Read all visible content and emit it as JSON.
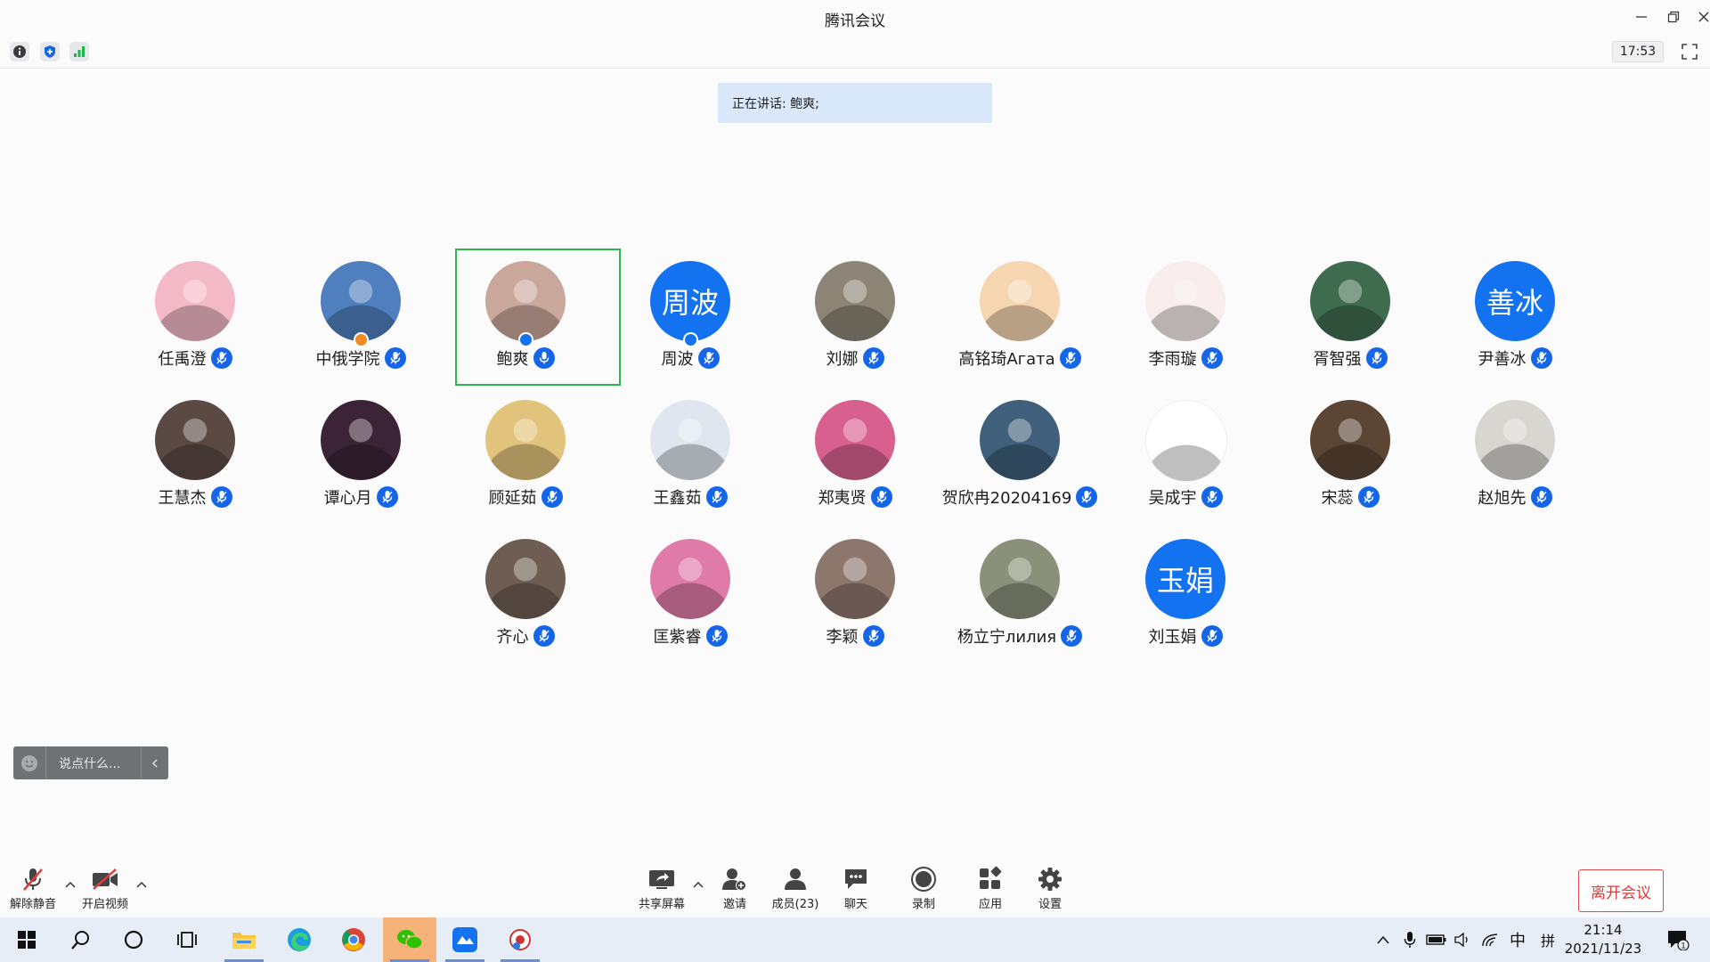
{
  "window": {
    "title": "腾讯会议"
  },
  "infobar": {
    "timer": "17:53"
  },
  "speaking": {
    "label": "正在讲话: 鲍爽;"
  },
  "participants": [
    {
      "name": "任禹澄",
      "avatar": "photo",
      "color": "#f4b9c7"
    },
    {
      "name": "中俄学院",
      "avatar": "photo",
      "color": "#4f7fbf",
      "badge": "host-orange"
    },
    {
      "name": "鲍爽",
      "avatar": "photo",
      "color": "#c9a79a",
      "badge": "host",
      "active": true,
      "speaking": true
    },
    {
      "name": "周波",
      "avatar": "initials",
      "initials": "周波",
      "badge": "host"
    },
    {
      "name": "刘娜",
      "avatar": "photo",
      "color": "#8c8576"
    },
    {
      "name": "高铭琦Агата",
      "avatar": "photo",
      "color": "#f6d5b1"
    },
    {
      "name": "李雨璇",
      "avatar": "photo",
      "color": "#f8ecec"
    },
    {
      "name": "胥智强",
      "avatar": "photo",
      "color": "#3f6b4e"
    },
    {
      "name": "尹善冰",
      "avatar": "initials",
      "initials": "善冰"
    },
    {
      "name": "王慧杰",
      "avatar": "photo",
      "color": "#5b4a44"
    },
    {
      "name": "谭心月",
      "avatar": "photo",
      "color": "#3a2435"
    },
    {
      "name": "顾延茹",
      "avatar": "photo",
      "color": "#e2c37b"
    },
    {
      "name": "王鑫茹",
      "avatar": "photo",
      "color": "#dfe6ee"
    },
    {
      "name": "郑夷贤",
      "avatar": "photo",
      "color": "#d8608f"
    },
    {
      "name": "贺欣冉20204169",
      "avatar": "photo",
      "color": "#3f5f7a"
    },
    {
      "name": "吴成宇",
      "avatar": "photo",
      "color": "#ffffff"
    },
    {
      "name": "宋蕊",
      "avatar": "photo",
      "color": "#5b4535"
    },
    {
      "name": "赵旭先",
      "avatar": "photo",
      "color": "#d8d6d0"
    },
    {
      "name": "齐心",
      "avatar": "photo",
      "color": "#6d5d52"
    },
    {
      "name": "匡紫睿",
      "avatar": "photo",
      "color": "#e07aa8"
    },
    {
      "name": "李颖",
      "avatar": "photo",
      "color": "#8d776d"
    },
    {
      "name": "杨立宁лилия",
      "avatar": "photo",
      "color": "#8a907a"
    },
    {
      "name": "刘玉娟",
      "avatar": "initials",
      "initials": "玉娟"
    }
  ],
  "chat": {
    "placeholder": "说点什么..."
  },
  "toolbar": {
    "unmute": "解除静音",
    "start_video": "开启视频",
    "share_screen": "共享屏幕",
    "invite": "邀请",
    "members": "成员(23)",
    "chat": "聊天",
    "record": "录制",
    "apps": "应用",
    "settings": "设置",
    "leave": "离开会议"
  },
  "taskbar": {
    "apps": [
      "start-icon",
      "search-icon",
      "cortana-icon",
      "task-view-icon",
      "file-explorer-icon",
      "edge-icon",
      "chrome-icon",
      "wechat-icon",
      "tencent-meeting-icon",
      "app-icon"
    ],
    "ime_lang": "中",
    "ime_mode": "拼",
    "time": "21:14",
    "date": "2021/11/23",
    "notifications": "1"
  },
  "colors": {
    "accent": "#1372f0",
    "active_frame": "#2ab44e",
    "leave": "#e23b3b",
    "speaking_bg": "#d9e8fb"
  }
}
